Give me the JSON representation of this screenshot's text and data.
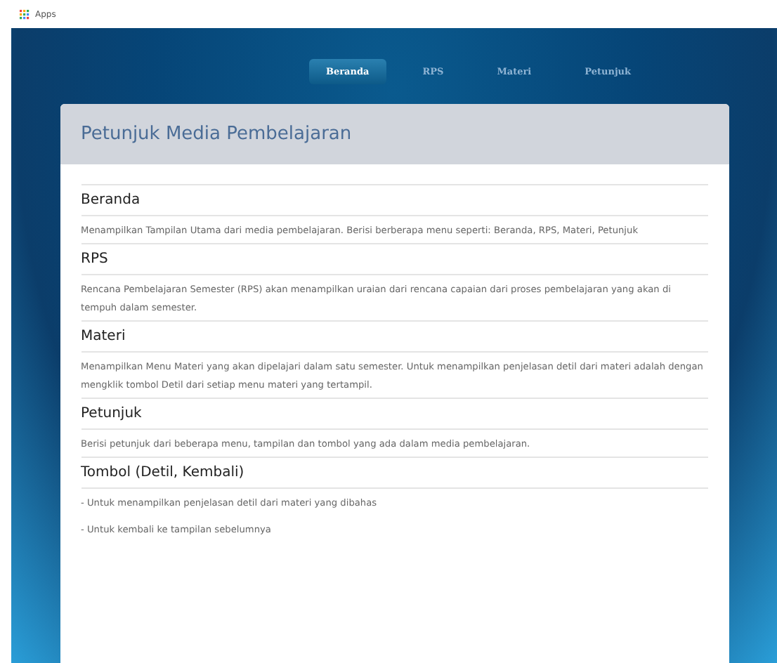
{
  "bookmarks_bar": {
    "apps_label": "Apps"
  },
  "nav": [
    {
      "label": "Beranda",
      "selected": true
    },
    {
      "label": "RPS",
      "selected": false
    },
    {
      "label": "Materi",
      "selected": false
    },
    {
      "label": "Petunjuk",
      "selected": false
    }
  ],
  "card": {
    "title": "Petunjuk Media Pembelajaran",
    "sections": [
      {
        "heading": "Beranda",
        "paragraphs": [
          "Menampilkan Tampilan Utama dari media pembelajaran. Berisi berberapa menu seperti: Beranda, RPS, Materi, Petunjuk"
        ]
      },
      {
        "heading": "RPS",
        "paragraphs": [
          "Rencana Pembelajaran Semester (RPS) akan menampilkan uraian dari rencana capaian dari proses pembelajaran yang akan di tempuh dalam semester."
        ]
      },
      {
        "heading": "Materi",
        "paragraphs": [
          "Menampilkan Menu Materi yang akan dipelajari dalam satu semester. Untuk menampilkan penjelasan detil dari materi adalah dengan mengklik tombol Detil dari setiap menu materi yang tertampil."
        ]
      },
      {
        "heading": "Petunjuk",
        "paragraphs": [
          "Berisi petunjuk dari beberapa menu, tampilan dan tombol yang ada dalam media pembelajaran."
        ]
      },
      {
        "heading": "Tombol (Detil, Kembali)",
        "paragraphs": [
          "- Untuk menampilkan penjelasan detil dari materi yang dibahas",
          "- Untuk kembali ke tampilan sebelumnya"
        ]
      }
    ]
  }
}
